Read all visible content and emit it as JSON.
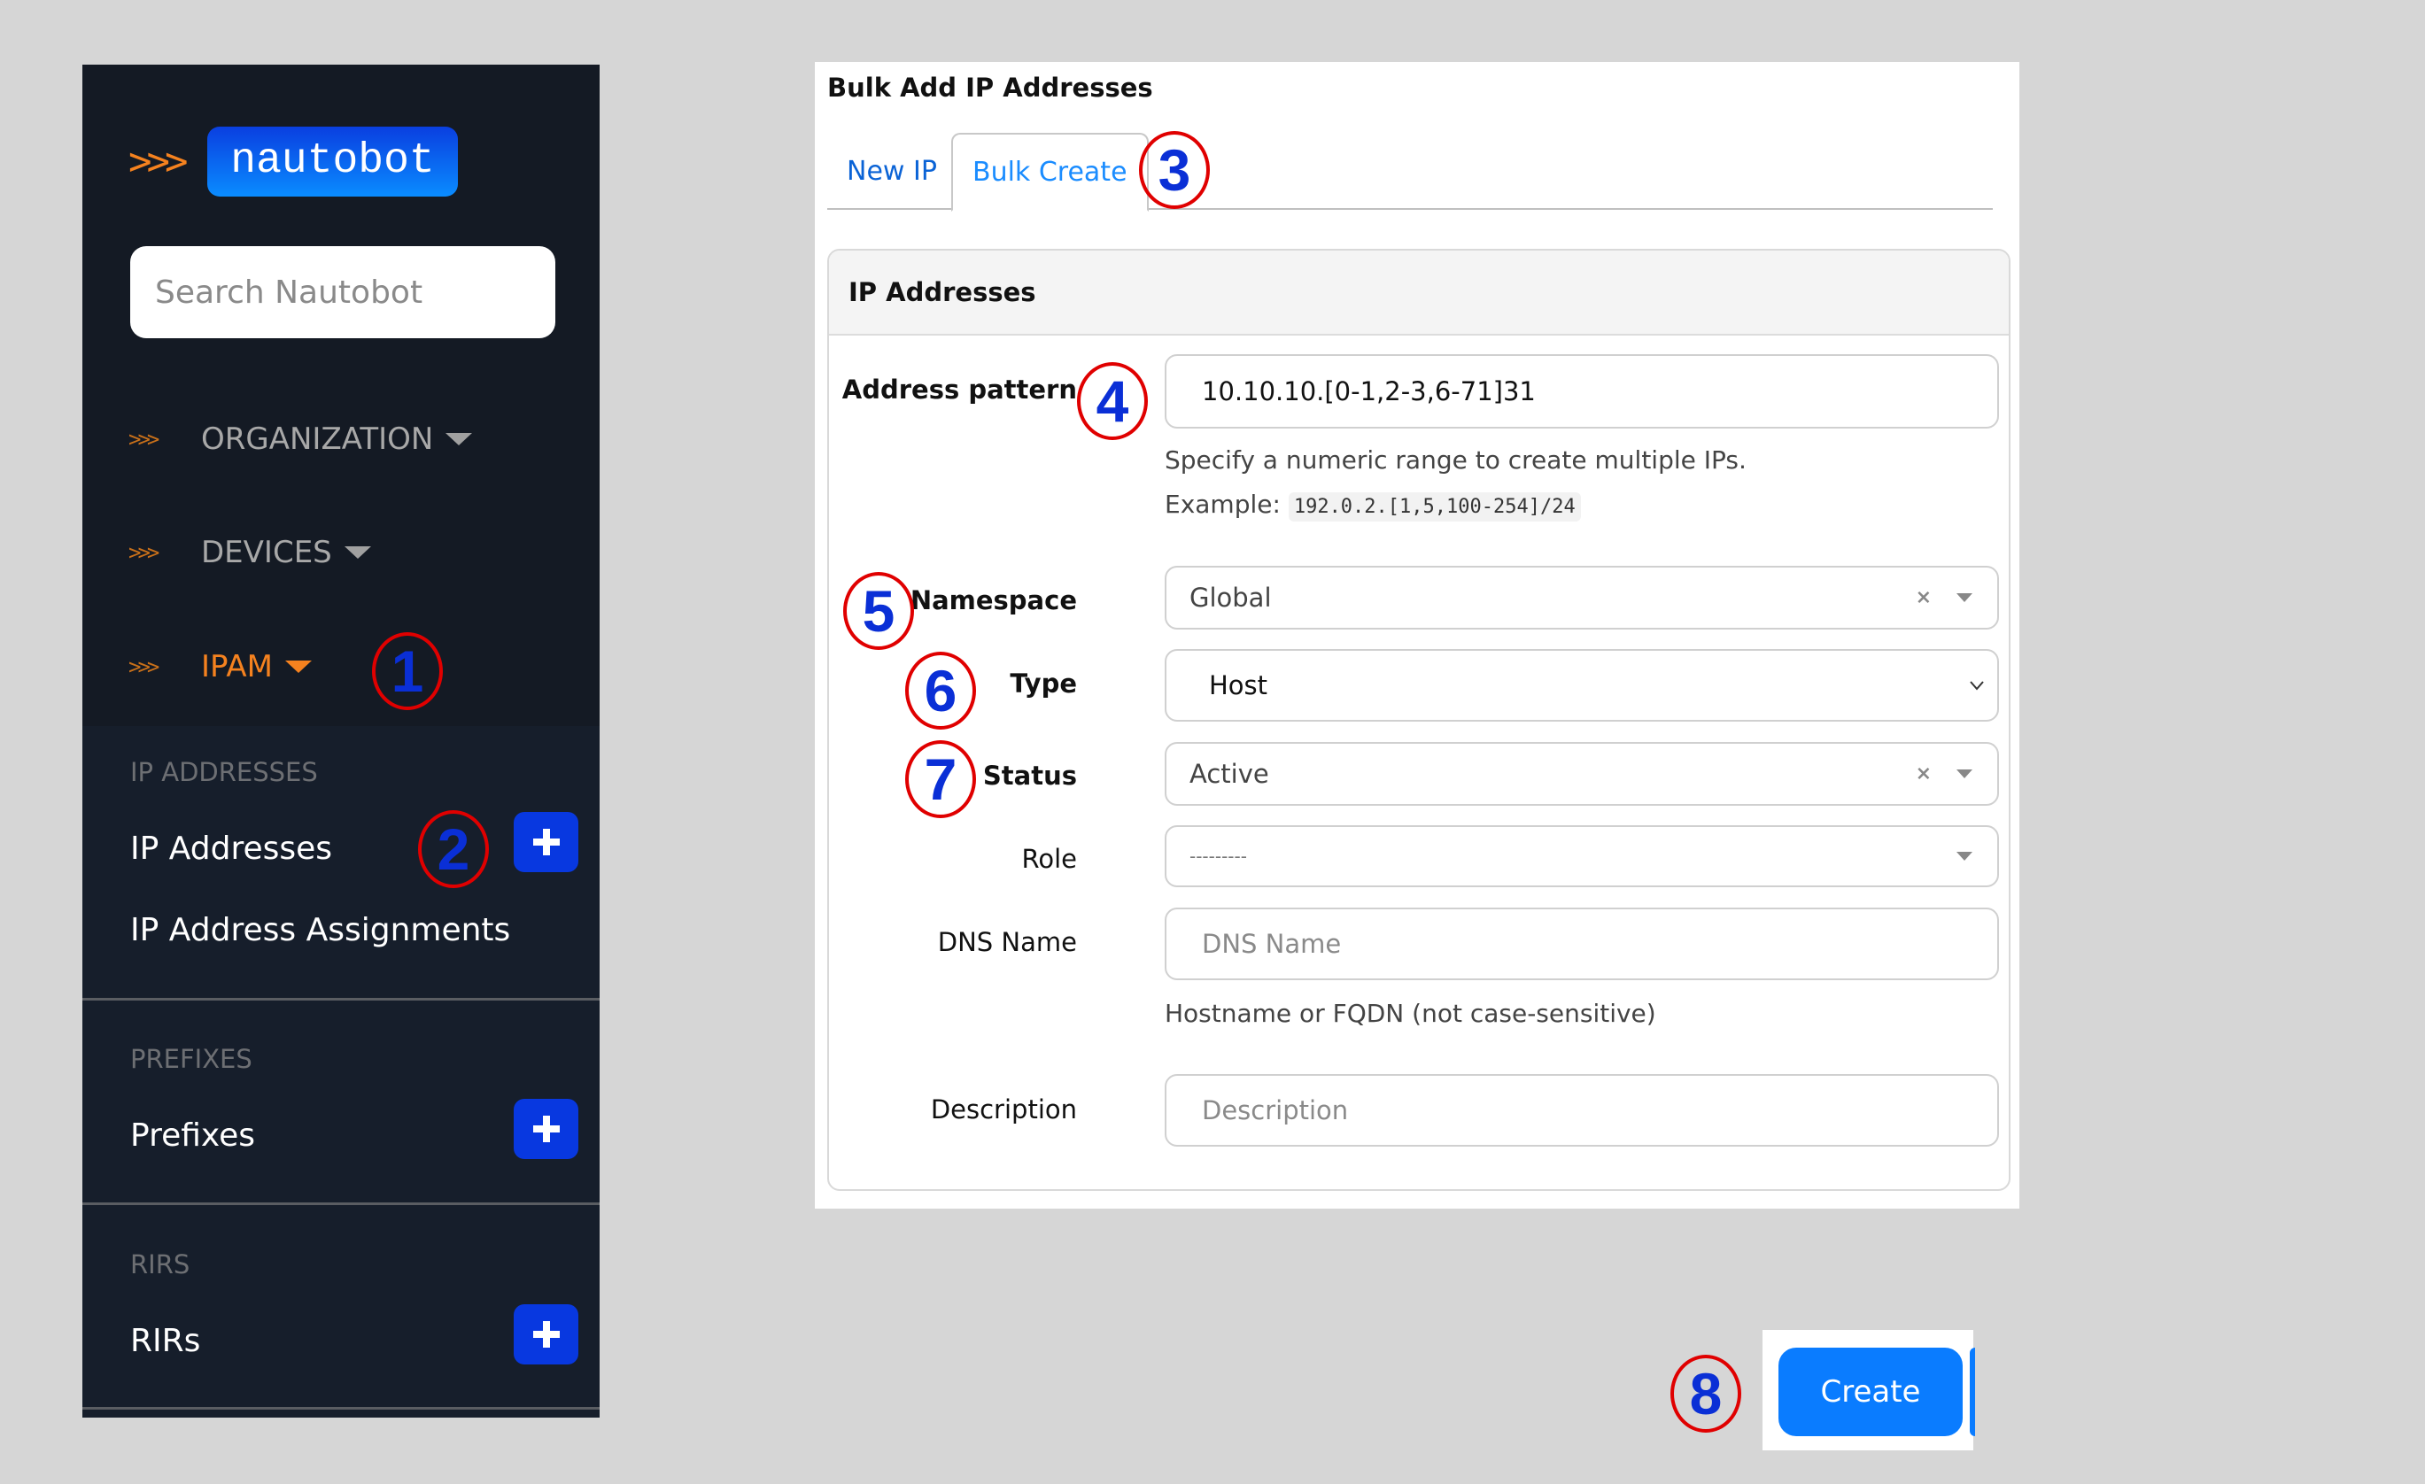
{
  "sidebar": {
    "logo_chevrons": ">>>",
    "logo_text": "nautobot",
    "search_placeholder": "Search Nautobot",
    "top_menu": [
      {
        "chevrons": ">>>",
        "label": "ORGANIZATION",
        "active": false
      },
      {
        "chevrons": ">>>",
        "label": "DEVICES",
        "active": false
      },
      {
        "chevrons": ">>>",
        "label": "IPAM",
        "active": true
      }
    ],
    "groups": [
      {
        "header": "IP ADDRESSES",
        "items": [
          {
            "label": "IP Addresses",
            "has_add": true
          },
          {
            "label": "IP Address Assignments",
            "has_add": false
          }
        ]
      },
      {
        "header": "PREFIXES",
        "items": [
          {
            "label": "Prefixes",
            "has_add": true
          }
        ]
      },
      {
        "header": "RIRS",
        "items": [
          {
            "label": "RIRs",
            "has_add": true
          }
        ]
      }
    ],
    "add_icon": "plus-icon"
  },
  "panel": {
    "title": "Bulk Add IP Addresses",
    "tabs": [
      {
        "label": "New IP",
        "active": false
      },
      {
        "label": "Bulk Create",
        "active": true
      }
    ],
    "card_title": "IP Addresses",
    "fields": {
      "address_pattern": {
        "label": "Address pattern",
        "value": "10.10.10.[0-1,2-3,6-71]31",
        "help": "Specify a numeric range to create multiple IPs.",
        "example_label": "Example:",
        "example_code": "192.0.2.[1,5,100-254]/24"
      },
      "namespace": {
        "label": "Namespace",
        "value": "Global",
        "clear": "×"
      },
      "type": {
        "label": "Type",
        "value": "Host"
      },
      "status": {
        "label": "Status",
        "value": "Active",
        "clear": "×"
      },
      "role": {
        "label": "Role",
        "value": "---------"
      },
      "dns_name": {
        "label": "DNS Name",
        "placeholder": "DNS Name",
        "value": "",
        "help": "Hostname or FQDN (not case-sensitive)"
      },
      "description": {
        "label": "Description",
        "placeholder": "Description",
        "value": ""
      }
    },
    "create_label": "Create"
  },
  "annotations": [
    "1",
    "2",
    "3",
    "4",
    "5",
    "6",
    "7",
    "8"
  ],
  "colors": {
    "sidebar_bg": "#141a24",
    "accent_orange": "#f5821f",
    "primary_blue": "#0a7cff",
    "add_button_blue": "#0838e0",
    "marker_ring": "#e00000",
    "marker_digit": "#0a2fd6"
  }
}
